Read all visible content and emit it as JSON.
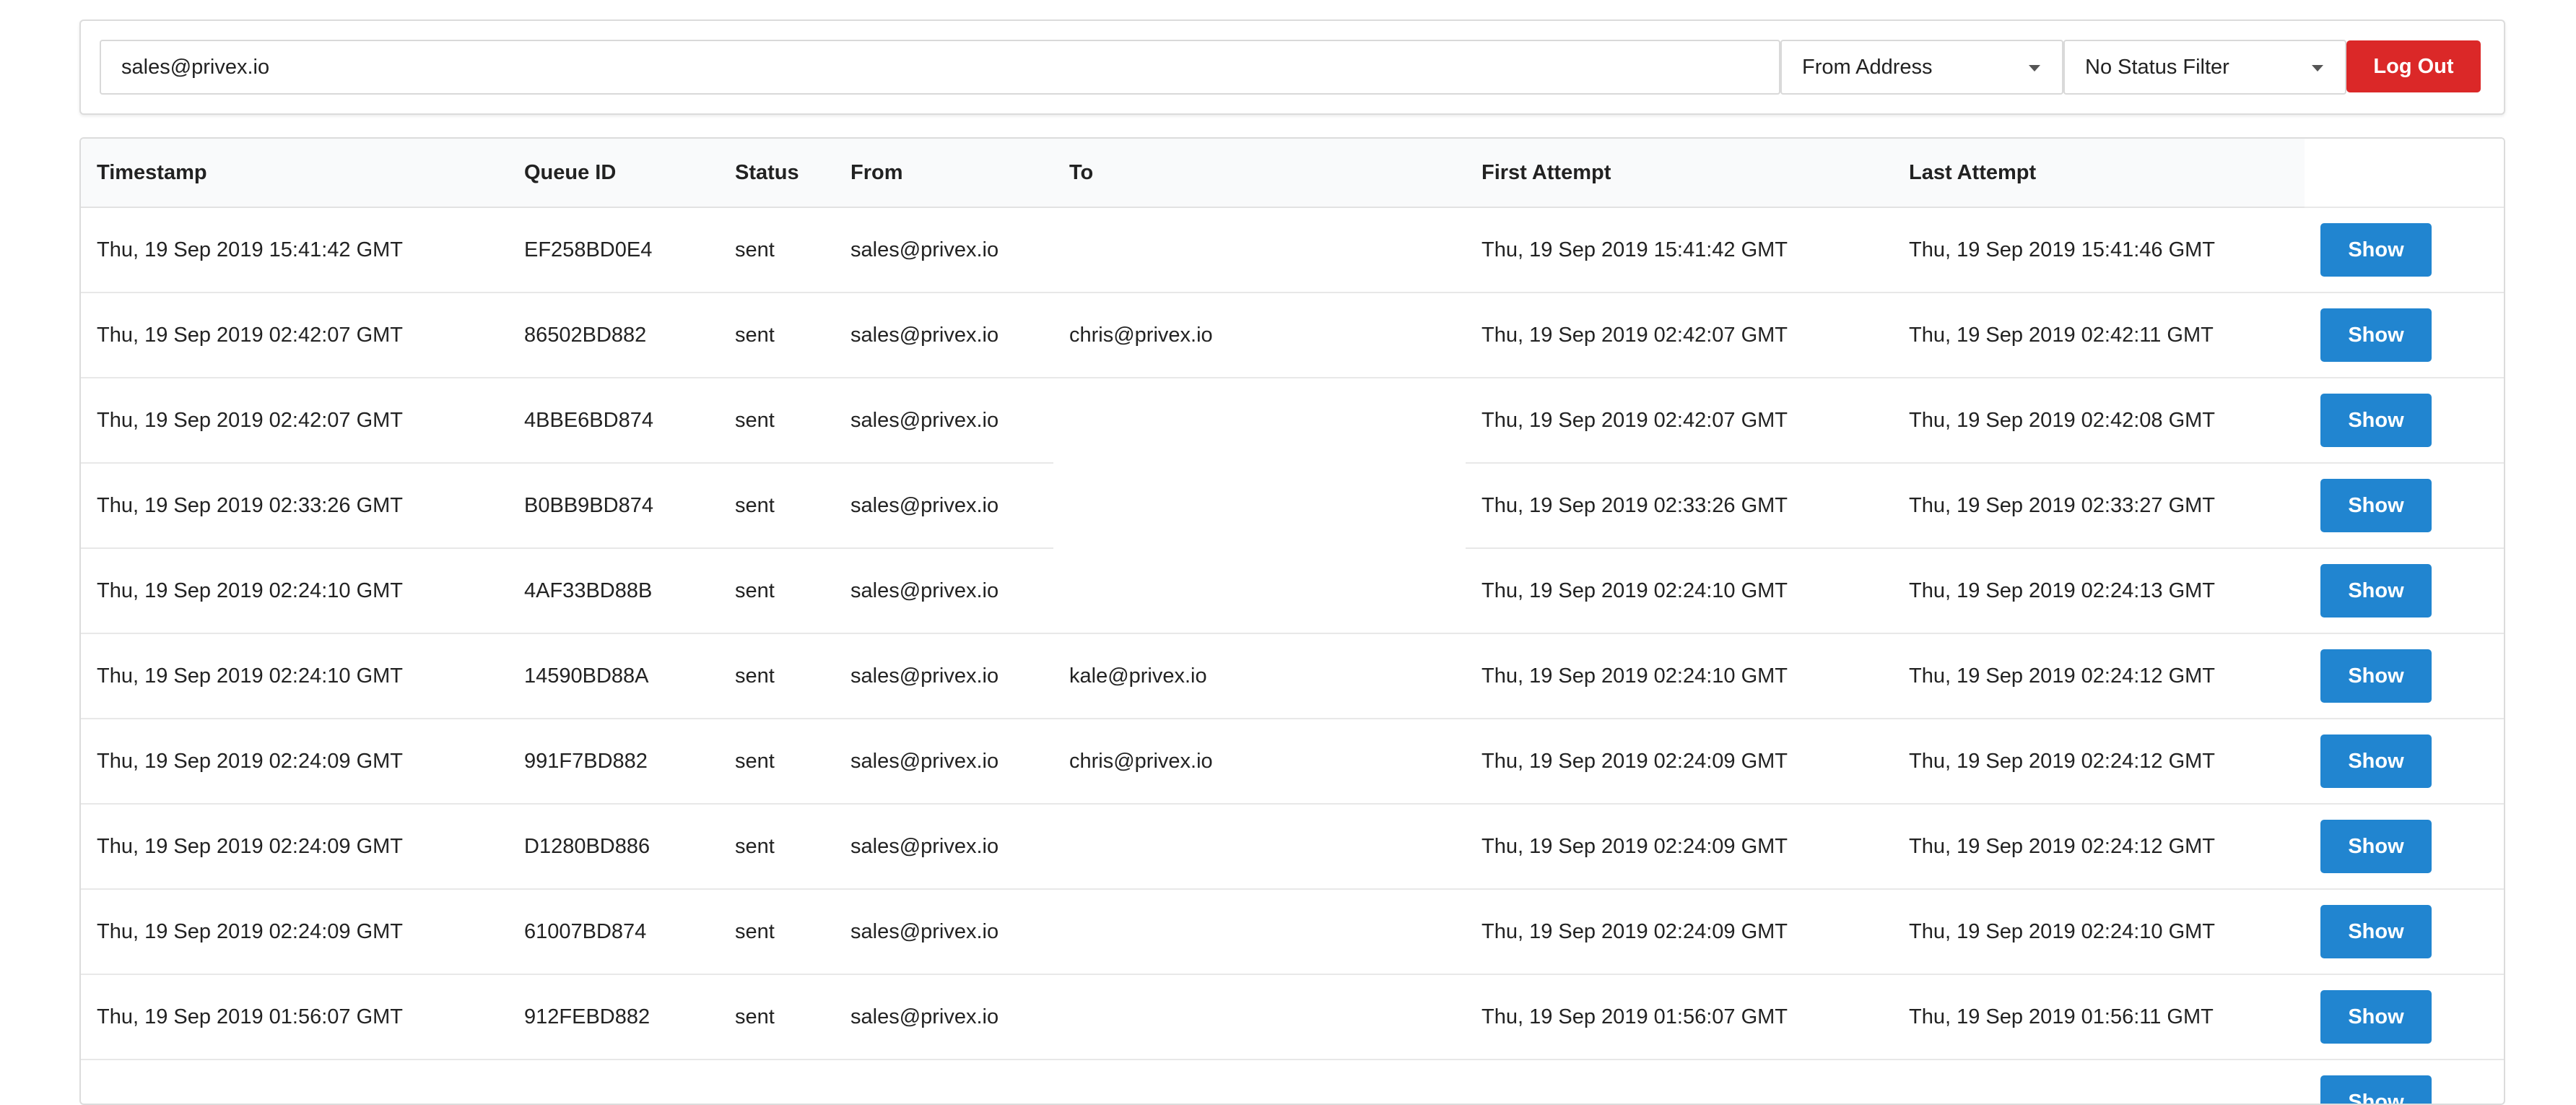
{
  "filters": {
    "search_value": "sales@privex.io",
    "field_select_value": "From Address",
    "status_select_value": "No Status Filter",
    "logout_label": "Log Out"
  },
  "table": {
    "headers": {
      "timestamp": "Timestamp",
      "queue_id": "Queue ID",
      "status": "Status",
      "from": "From",
      "to": "To",
      "first_attempt": "First Attempt",
      "last_attempt": "Last Attempt"
    },
    "show_label": "Show",
    "rows": [
      {
        "timestamp": "Thu, 19 Sep 2019 15:41:42 GMT",
        "queue_id": "EF258BD0E4",
        "status": "sent",
        "from": "sales@privex.io",
        "to": "",
        "first_attempt": "Thu, 19 Sep 2019 15:41:42 GMT",
        "last_attempt": "Thu, 19 Sep 2019 15:41:46 GMT"
      },
      {
        "timestamp": "Thu, 19 Sep 2019 02:42:07 GMT",
        "queue_id": "86502BD882",
        "status": "sent",
        "from": "sales@privex.io",
        "to": "chris@privex.io",
        "first_attempt": "Thu, 19 Sep 2019 02:42:07 GMT",
        "last_attempt": "Thu, 19 Sep 2019 02:42:11 GMT"
      },
      {
        "timestamp": "Thu, 19 Sep 2019 02:42:07 GMT",
        "queue_id": "4BBE6BD874",
        "status": "sent",
        "from": "sales@privex.io",
        "to": "",
        "first_attempt": "Thu, 19 Sep 2019 02:42:07 GMT",
        "last_attempt": "Thu, 19 Sep 2019 02:42:08 GMT"
      },
      {
        "timestamp": "Thu, 19 Sep 2019 02:33:26 GMT",
        "queue_id": "B0BB9BD874",
        "status": "sent",
        "from": "sales@privex.io",
        "to": "",
        "first_attempt": "Thu, 19 Sep 2019 02:33:26 GMT",
        "last_attempt": "Thu, 19 Sep 2019 02:33:27 GMT"
      },
      {
        "timestamp": "Thu, 19 Sep 2019 02:24:10 GMT",
        "queue_id": "4AF33BD88B",
        "status": "sent",
        "from": "sales@privex.io",
        "to": "",
        "first_attempt": "Thu, 19 Sep 2019 02:24:10 GMT",
        "last_attempt": "Thu, 19 Sep 2019 02:24:13 GMT"
      },
      {
        "timestamp": "Thu, 19 Sep 2019 02:24:10 GMT",
        "queue_id": "14590BD88A",
        "status": "sent",
        "from": "sales@privex.io",
        "to": "kale@privex.io",
        "first_attempt": "Thu, 19 Sep 2019 02:24:10 GMT",
        "last_attempt": "Thu, 19 Sep 2019 02:24:12 GMT"
      },
      {
        "timestamp": "Thu, 19 Sep 2019 02:24:09 GMT",
        "queue_id": "991F7BD882",
        "status": "sent",
        "from": "sales@privex.io",
        "to": "chris@privex.io",
        "first_attempt": "Thu, 19 Sep 2019 02:24:09 GMT",
        "last_attempt": "Thu, 19 Sep 2019 02:24:12 GMT"
      },
      {
        "timestamp": "Thu, 19 Sep 2019 02:24:09 GMT",
        "queue_id": "D1280BD886",
        "status": "sent",
        "from": "sales@privex.io",
        "to": "",
        "first_attempt": "Thu, 19 Sep 2019 02:24:09 GMT",
        "last_attempt": "Thu, 19 Sep 2019 02:24:12 GMT"
      },
      {
        "timestamp": "Thu, 19 Sep 2019 02:24:09 GMT",
        "queue_id": "61007BD874",
        "status": "sent",
        "from": "sales@privex.io",
        "to": "",
        "first_attempt": "Thu, 19 Sep 2019 02:24:09 GMT",
        "last_attempt": "Thu, 19 Sep 2019 02:24:10 GMT"
      },
      {
        "timestamp": "Thu, 19 Sep 2019 01:56:07 GMT",
        "queue_id": "912FEBD882",
        "status": "sent",
        "from": "sales@privex.io",
        "to": "",
        "first_attempt": "Thu, 19 Sep 2019 01:56:07 GMT",
        "last_attempt": "Thu, 19 Sep 2019 01:56:11 GMT"
      },
      {
        "timestamp": "",
        "queue_id": "",
        "status": "",
        "from": "",
        "to": "",
        "first_attempt": "",
        "last_attempt": ""
      }
    ]
  }
}
